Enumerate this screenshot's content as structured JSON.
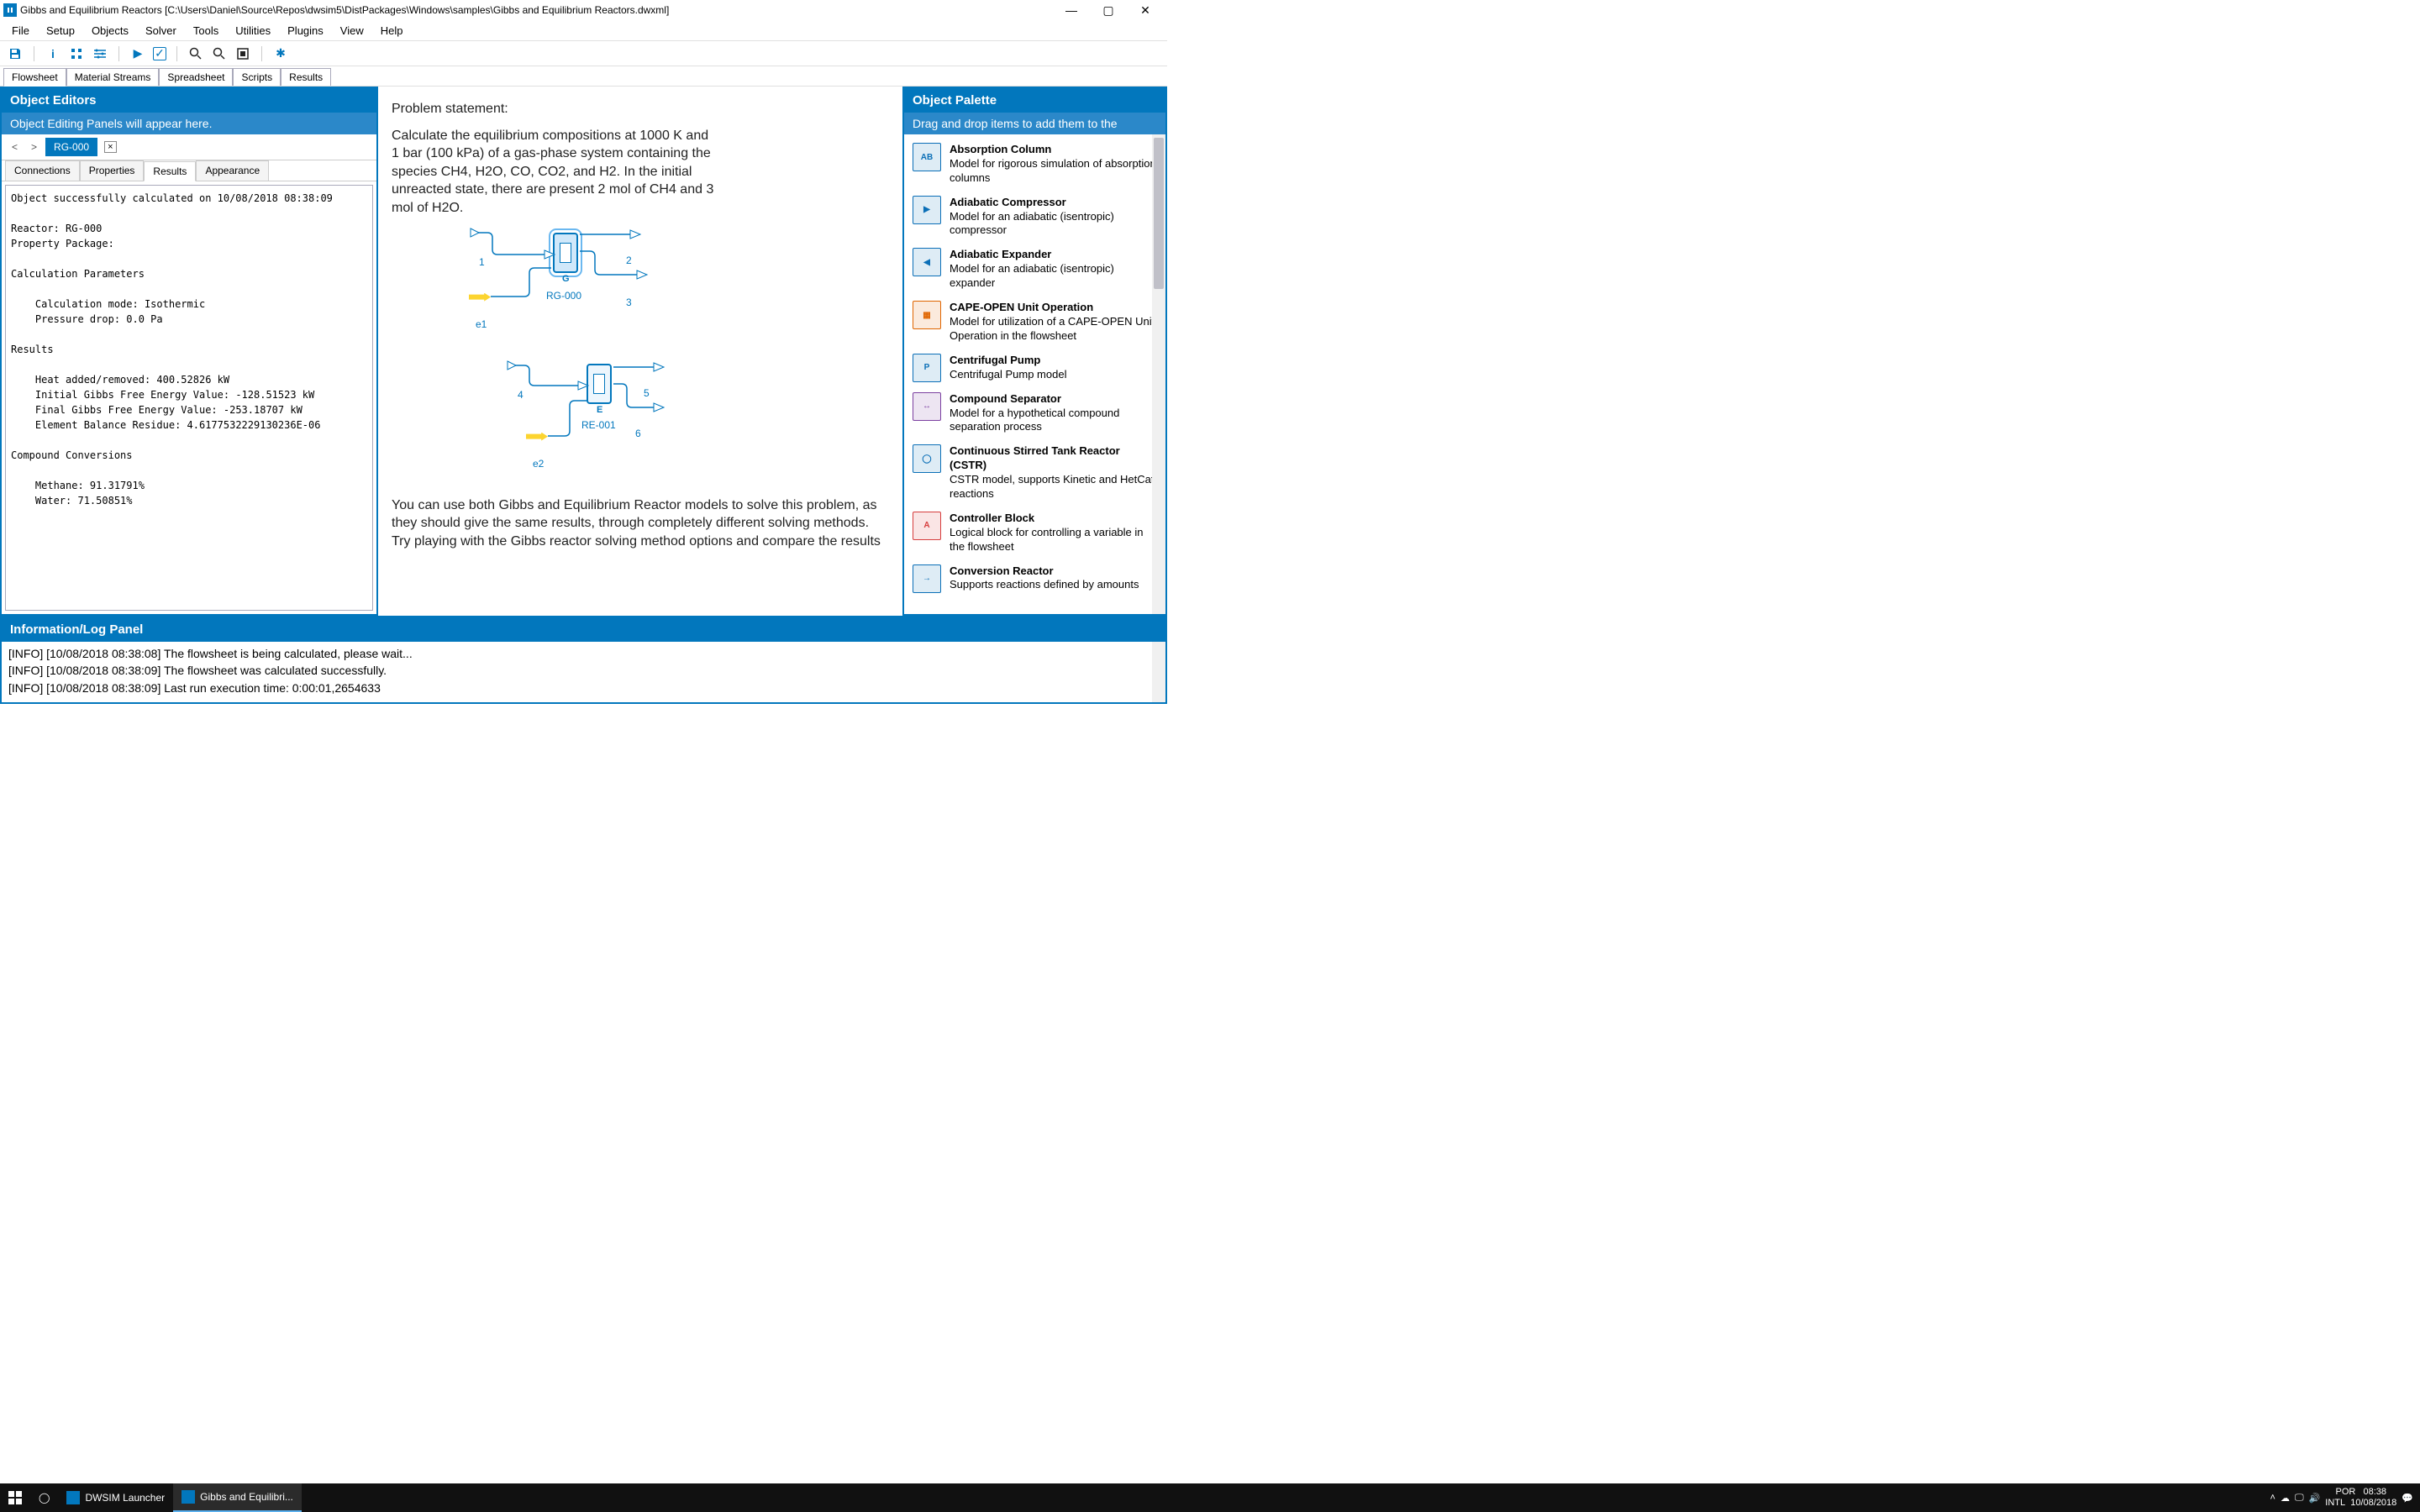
{
  "window": {
    "title": "Gibbs and Equilibrium Reactors [C:\\Users\\Daniel\\Source\\Repos\\dwsim5\\DistPackages\\Windows\\samples\\Gibbs and Equilibrium Reactors.dwxml]"
  },
  "menu": [
    "File",
    "Setup",
    "Objects",
    "Solver",
    "Tools",
    "Utilities",
    "Plugins",
    "View",
    "Help"
  ],
  "tabs": [
    "Flowsheet",
    "Material Streams",
    "Spreadsheet",
    "Scripts",
    "Results"
  ],
  "active_tab": "Flowsheet",
  "editor": {
    "header": "Object Editors",
    "subheader": "Object Editing Panels will appear here.",
    "object_tab": "RG-000",
    "subtabs": [
      "Connections",
      "Properties",
      "Results",
      "Appearance"
    ],
    "active_subtab": "Results",
    "results_text": "Object successfully calculated on 10/08/2018 08:38:09\n\nReactor: RG-000\nProperty Package:\n\nCalculation Parameters\n\n    Calculation mode: Isothermic\n    Pressure drop: 0.0 Pa\n\nResults\n\n    Heat added/removed: 400.52826 kW\n    Initial Gibbs Free Energy Value: -128.51523 kW\n    Final Gibbs Free Energy Value: -253.18707 kW\n    Element Balance Residue: 4.6177532229130236E-06\n\nCompound Conversions\n\n    Methane: 91.31791%\n    Water: 71.50851%"
  },
  "problem": {
    "title": "Problem statement:",
    "body": "Calculate the equilibrium compositions at 1000 K and 1 bar (100 kPa) of a gas-phase system containing the species CH4, H2O, CO, CO2, and H2. In the initial unreacted state, there are present 2 mol of CH4 and 3 mol of H2O.",
    "footer": "You can use both Gibbs and Equilibrium Reactor models to solve this problem, as they should give the same results, through completely different solving methods. Try playing with the Gibbs reactor solving method options and compare the results"
  },
  "flowsheet": {
    "r1": {
      "name": "RG-000",
      "letter": "G"
    },
    "r2": {
      "name": "RE-001",
      "letter": "E"
    },
    "s1": "1",
    "s2": "2",
    "s3": "3",
    "s4": "4",
    "s5": "5",
    "s6": "6",
    "e1": "e1",
    "e2": "e2"
  },
  "palette": {
    "header": "Object Palette",
    "subheader": "Drag and drop items to add them to the",
    "items": [
      {
        "title": "Absorption Column",
        "desc": "Model for rigorous simulation of absorption columns",
        "icon": "AB",
        "color": "#0b6fb7"
      },
      {
        "title": "Adiabatic Compressor",
        "desc": "Model for an adiabatic (isentropic) compressor",
        "icon": "▶",
        "color": "#0b6fb7"
      },
      {
        "title": "Adiabatic Expander",
        "desc": "Model for an adiabatic (isentropic) expander",
        "icon": "◀",
        "color": "#0b6fb7"
      },
      {
        "title": "CAPE-OPEN Unit Operation",
        "desc": "Model for utilization of a CAPE-OPEN Unit Operation in the flowsheet",
        "icon": "▦",
        "color": "#e06500"
      },
      {
        "title": "Centrifugal Pump",
        "desc": "Centrifugal Pump model",
        "icon": "P",
        "color": "#0b6fb7"
      },
      {
        "title": "Compound Separator",
        "desc": "Model for a hypothetical compound separation process",
        "icon": "↔",
        "color": "#7b3fa0"
      },
      {
        "title": "Continuous Stirred Tank Reactor (CSTR)",
        "desc": "CSTR model, supports Kinetic and HetCat reactions",
        "icon": "◯",
        "color": "#0b6fb7"
      },
      {
        "title": "Controller Block",
        "desc": "Logical block for controlling a variable in the flowsheet",
        "icon": "A",
        "color": "#d63d3d"
      },
      {
        "title": "Conversion Reactor",
        "desc": "Supports reactions defined by amounts",
        "icon": "→",
        "color": "#0b6fb7"
      }
    ]
  },
  "log": {
    "header": "Information/Log Panel",
    "lines": [
      "[INFO] [10/08/2018 08:38:08] The flowsheet is being calculated, please wait...",
      "[INFO] [10/08/2018 08:38:09] The flowsheet was calculated successfully.",
      "[INFO] [10/08/2018 08:38:09] Last run execution time: 0:00:01,2654633"
    ]
  },
  "taskbar": {
    "app1": "DWSIM Launcher",
    "app2": "Gibbs and Equilibri...",
    "lang": "POR",
    "kb": "INTL",
    "time": "08:38",
    "date": "10/08/2018"
  }
}
